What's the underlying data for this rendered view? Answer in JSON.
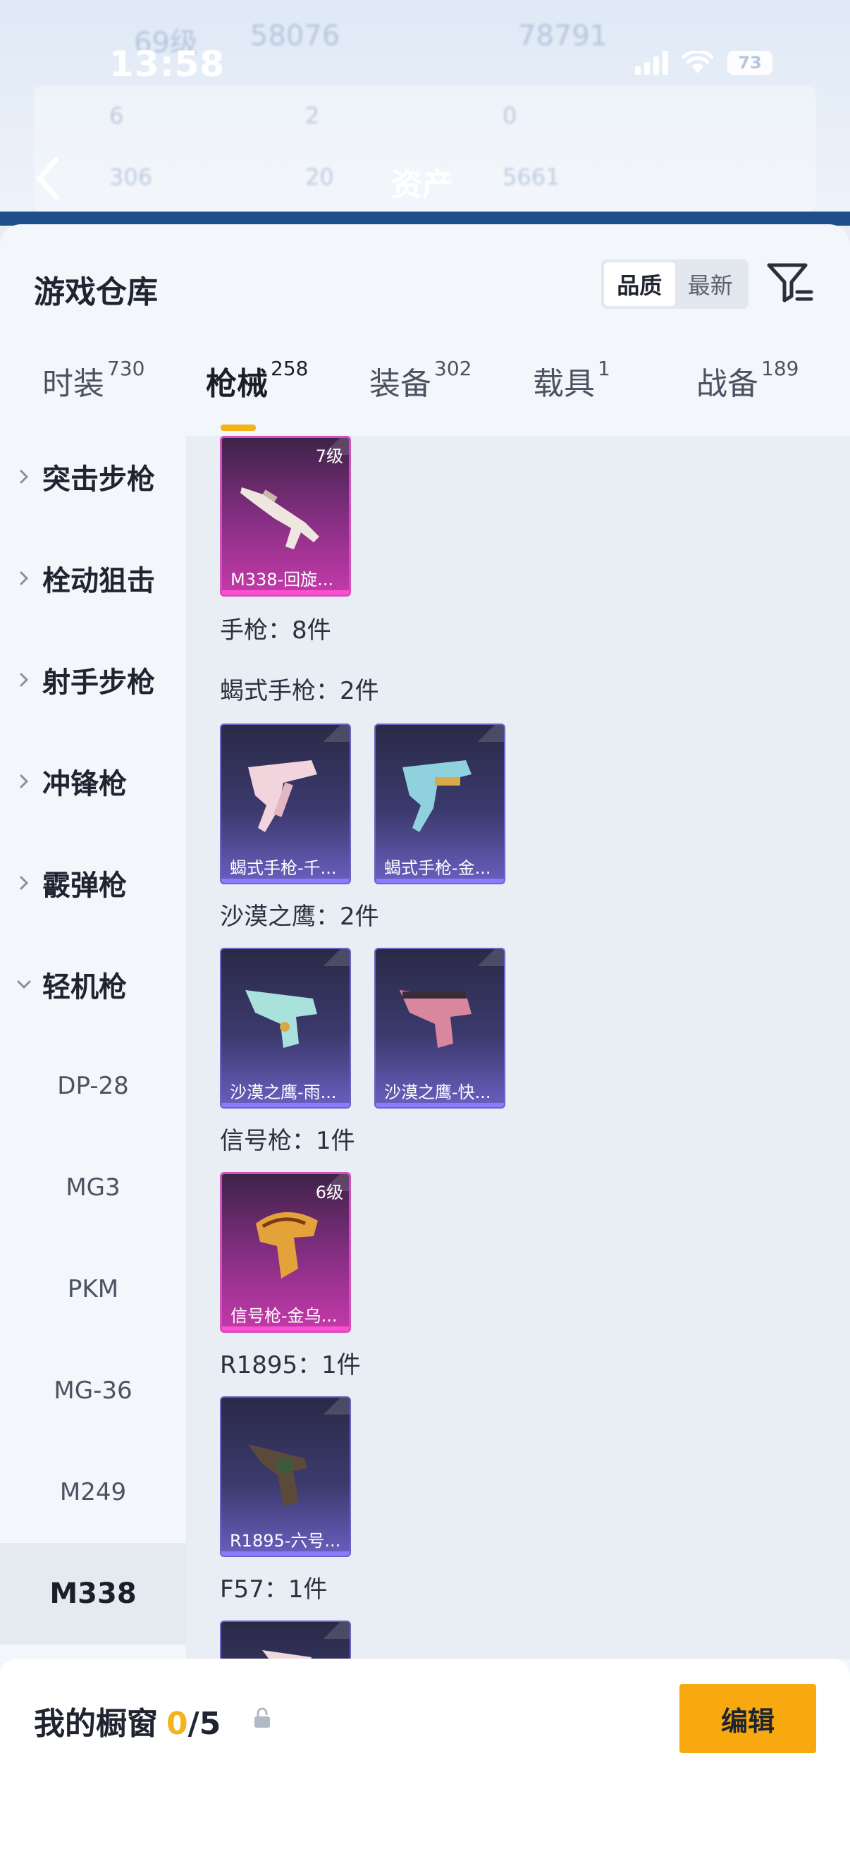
{
  "status_bar": {
    "time": "13:58",
    "battery": "73"
  },
  "background_header": {
    "title": "资产",
    "ghost_values": [
      "69级",
      "58076",
      "78791",
      "6",
      "2",
      "0",
      "306",
      "20",
      "5661"
    ]
  },
  "sheet": {
    "title": "游戏仓库",
    "sort_options": [
      "品质",
      "最新"
    ],
    "active_sort": "品质"
  },
  "tabs": [
    {
      "label": "时装",
      "count": "730"
    },
    {
      "label": "枪械",
      "count": "258"
    },
    {
      "label": "装备",
      "count": "302"
    },
    {
      "label": "载具",
      "count": "1"
    },
    {
      "label": "战备",
      "count": "189"
    }
  ],
  "active_tab": "枪械",
  "left_nav": {
    "categories": [
      "突击步枪",
      "栓动狙击",
      "射手步枪",
      "冲锋枪",
      "霰弹枪",
      "轻机枪"
    ],
    "expanded_category": "轻机枪",
    "sub_items": [
      "DP-28",
      "MG3",
      "PKM",
      "MG-36",
      "M249",
      "M338"
    ],
    "active_sub_item": "M338"
  },
  "content": {
    "sections": [
      {
        "label": "手枪：8件"
      },
      {
        "label": "蝎式手枪：2件"
      },
      {
        "label": "沙漠之鹰：2件"
      },
      {
        "label": "信号枪：1件"
      },
      {
        "label": "R1895：1件"
      },
      {
        "label": "F57：1件"
      }
    ],
    "cards": [
      {
        "name": "M338-回旋...",
        "level": "7级",
        "rarity": "pink"
      },
      {
        "name": "蝎式手枪-千...",
        "level": "",
        "rarity": "purple"
      },
      {
        "name": "蝎式手枪-金...",
        "level": "",
        "rarity": "purple"
      },
      {
        "name": "沙漠之鹰-雨...",
        "level": "",
        "rarity": "purple"
      },
      {
        "name": "沙漠之鹰-快...",
        "level": "",
        "rarity": "purple"
      },
      {
        "name": "信号枪-金乌...",
        "level": "6级",
        "rarity": "pink"
      },
      {
        "name": "R1895-六号...",
        "level": "",
        "rarity": "purple"
      }
    ]
  },
  "bottom_bar": {
    "label": "我的橱窗",
    "current": "0",
    "total": "/5",
    "edit_label": "编辑"
  },
  "colors": {
    "accent": "#f7a90f",
    "tab_underline": "#f5b21b",
    "pink_rarity": "#d34fbf",
    "purple_rarity": "#6b63c6"
  },
  "icons": [
    "back-chevron-icon",
    "filter-icon",
    "chevron-right-icon",
    "chevron-down-icon",
    "share-icon",
    "lock-icon",
    "signal-icon",
    "wifi-icon",
    "battery-icon"
  ]
}
